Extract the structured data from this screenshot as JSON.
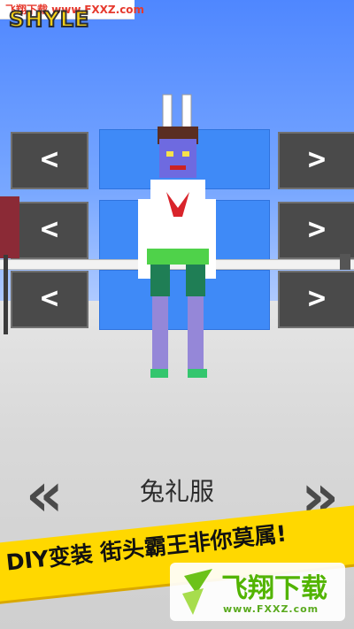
{
  "watermark": {
    "top_label": "飞翔下载 www.FXXZ.com"
  },
  "header": {
    "title_partial": "SHYLE"
  },
  "game": {
    "outfit_name": "兔礼服",
    "left_arrow_glyph": "<",
    "right_arrow_glyph": ">",
    "big_left_glyph": "«",
    "big_right_glyph": "»"
  },
  "banner": {
    "text": "DIY变装 街头霸王非你莫属!"
  },
  "logo": {
    "name": "飞翔下载",
    "url": "www.FXXZ.com"
  },
  "colors": {
    "sky": "#4f87ff",
    "panel": "#3f8af7",
    "button": "#4a4a4a",
    "banner": "#ffd800",
    "logo_green": "#52b400"
  },
  "icons": [
    "chevron-left-icon",
    "chevron-right-icon",
    "double-chevron-left-icon",
    "double-chevron-right-icon"
  ]
}
